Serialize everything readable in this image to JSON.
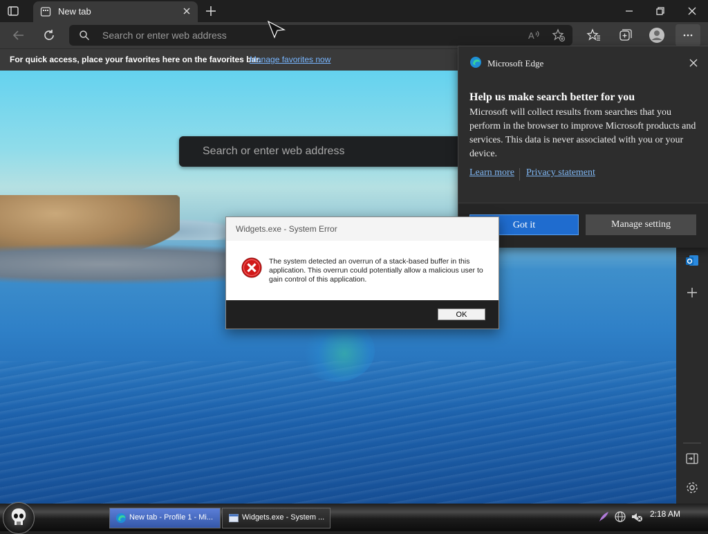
{
  "browser": {
    "tab_title": "New tab",
    "address_placeholder": "Search or enter web address"
  },
  "favorites_bar": {
    "message": "For quick access, place your favorites here on the favorites bar.",
    "link": "Manage favorites now"
  },
  "new_tab_page": {
    "search_placeholder": "Search or enter web address"
  },
  "flyout": {
    "app_name": "Microsoft Edge",
    "heading": "Help us make search better for you",
    "body": "Microsoft will collect results from searches that you perform in the browser to improve Microsoft products and services. This data is never associated with you or your device.",
    "learn_more": "Learn more",
    "privacy": "Privacy statement",
    "got_it": "Got it",
    "manage": "Manage setting"
  },
  "error_dialog": {
    "title": "Widgets.exe - System Error",
    "message": "The system detected an overrun of a stack-based buffer in this application. This overrun could potentially allow a malicious user to gain control of this application.",
    "ok": "OK"
  },
  "taskbar": {
    "tasks": [
      {
        "label": "New tab - Profile 1 - Mi..."
      },
      {
        "label": "Widgets.exe - System ..."
      }
    ],
    "clock": "2:18 AM"
  },
  "colors": {
    "accent": "#1f6ccf",
    "link": "#78b6ff",
    "error_red": "#d11a1a"
  }
}
